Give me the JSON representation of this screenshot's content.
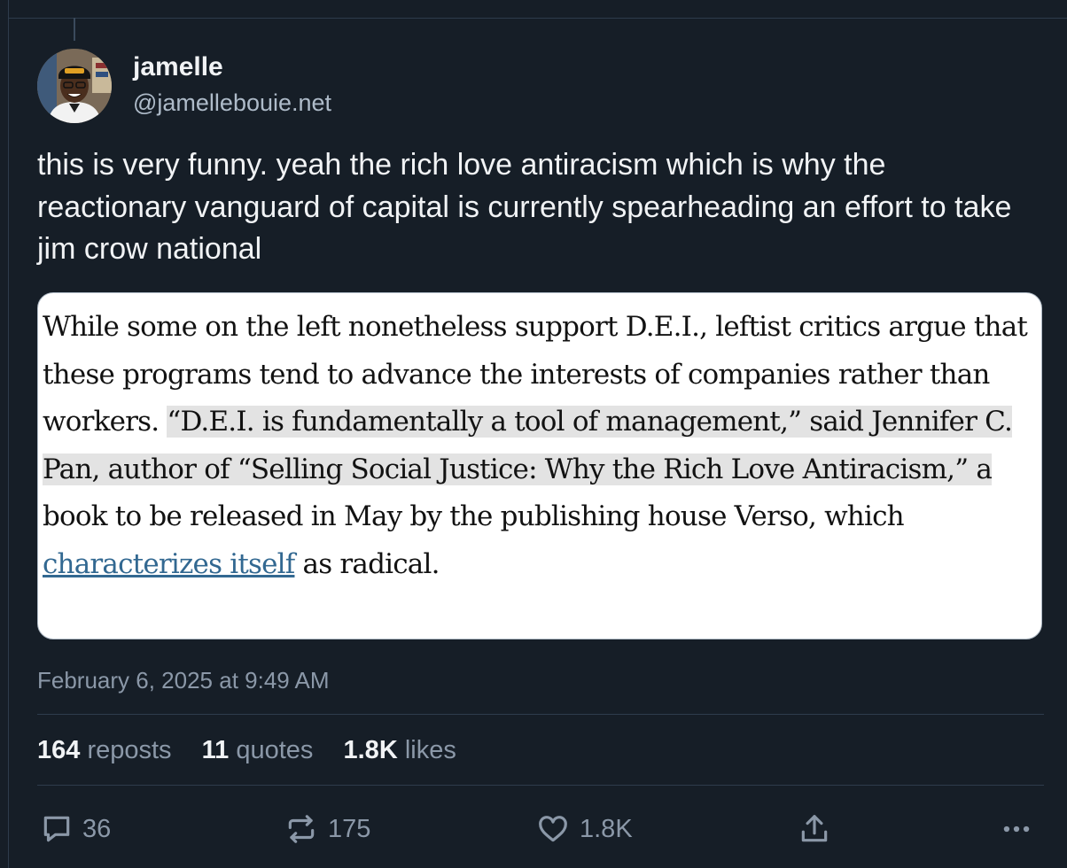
{
  "post": {
    "author": {
      "display_name": "jamelle",
      "handle": "@jamellebouie.net"
    },
    "text": "this is very funny. yeah the rich love antiracism which is why the reactionary vanguard of capital is currently spearheading an effort to take jim crow national",
    "quote_image": {
      "p1": "While some on the left nonetheless support D.E.I., leftist critics argue that these programs tend to advance the interests of companies rather than workers. ",
      "highlight": "“D.E.I. is fundamentally a tool of management,” said Jennifer C. Pan, author of “Selling Social Justice: Why the Rich Love Antiracism,” a",
      "p2": " book to be released in May by the publishing house Verso, which ",
      "link": "characterizes itself",
      "p3": " as radical."
    },
    "timestamp": "February 6, 2025 at 9:49 AM",
    "stats": {
      "reposts_num": "164",
      "reposts_label": "reposts",
      "quotes_num": "11",
      "quotes_label": "quotes",
      "likes_num": "1.8K",
      "likes_label": "likes"
    },
    "actions": {
      "reply_count": "36",
      "repost_count": "175",
      "like_count": "1.8K"
    }
  },
  "colors": {
    "background": "#161e27",
    "text_primary": "#f1f3f5",
    "text_secondary": "#8b98a8",
    "link": "#326891"
  },
  "icons": [
    "reply-icon",
    "repost-icon",
    "heart-icon",
    "share-icon",
    "more-icon"
  ]
}
